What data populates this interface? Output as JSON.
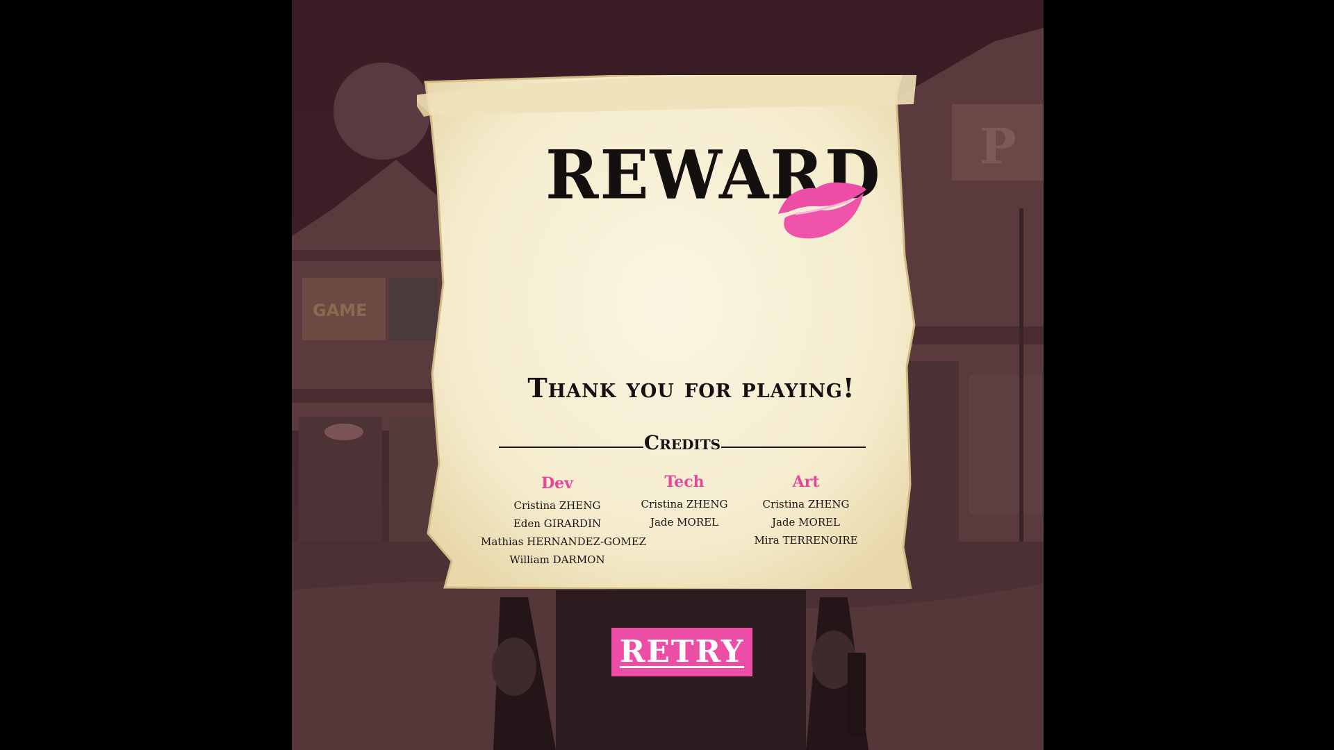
{
  "poster": {
    "title": "REWARD",
    "thanks": "Thank you for playing!",
    "credits_label": "Credits",
    "columns": [
      {
        "title": "Dev",
        "names": [
          "Cristina ZHENG",
          "Eden GIRARDIN",
          "Mathias HERNANDEZ-GOMEZ",
          "William DARMON"
        ]
      },
      {
        "title": "Tech",
        "names": [
          "Cristina ZHENG",
          "Jade MOREL"
        ]
      },
      {
        "title": "Art",
        "names": [
          "Cristina ZHENG",
          "Jade MOREL",
          "Mira TERRENOIRE"
        ]
      }
    ]
  },
  "retry": {
    "label": "RETRY"
  },
  "colors": {
    "accent": "#ec4ea6",
    "credit_heading": "#e6479b",
    "paper": "#f5ecd0",
    "background": "#3d2027"
  },
  "icons": {
    "kiss": "lipstick-kiss-icon",
    "moon": "moon-icon"
  }
}
